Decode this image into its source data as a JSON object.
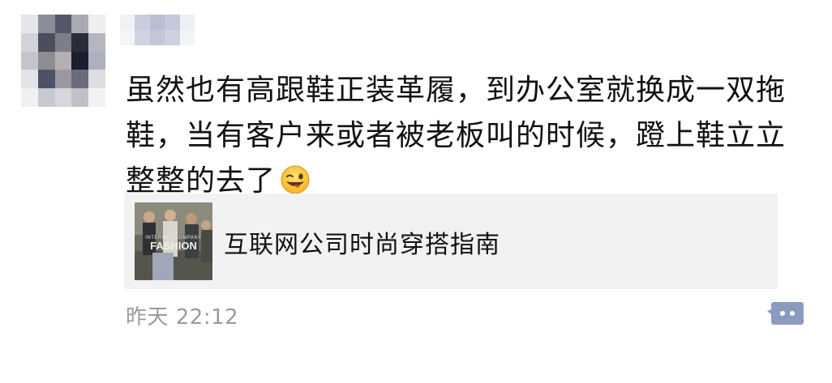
{
  "post": {
    "text": "虽然也有高跟鞋正装革履，到办公室就换成一双拖鞋，当有客户来或者被老板叫的时候，蹬上鞋立立整整的去了",
    "emoji": "winking-face-with-tongue-icon"
  },
  "share_card": {
    "title": "互联网公司时尚穿搭指南",
    "thumbnail": {
      "line1": "INTERNET COMPANY",
      "line2": "FASHION"
    }
  },
  "footer": {
    "timestamp": "昨天  22:12",
    "comment_icon": "comment-dots-icon"
  },
  "colors": {
    "text": "#111111",
    "muted": "#9a9a9a",
    "card_bg": "#f2f2f2",
    "comment_icon": "#8b9bbf"
  }
}
